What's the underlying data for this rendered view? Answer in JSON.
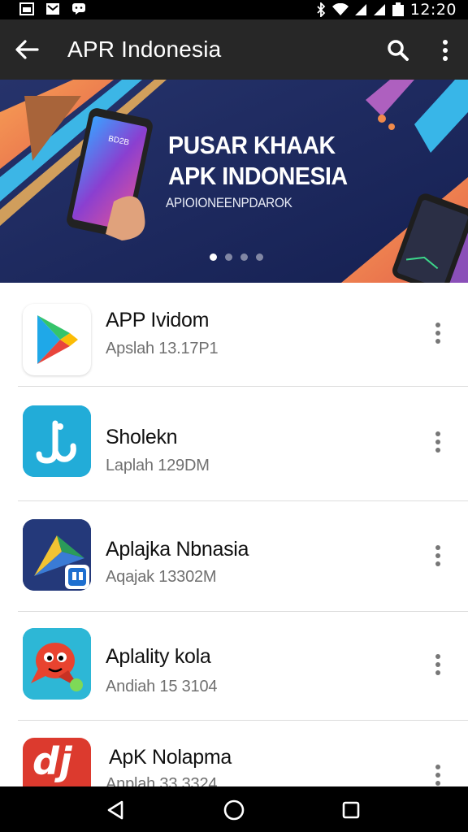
{
  "status_bar": {
    "time": "12:20",
    "icons": [
      "image-notification-icon",
      "mail-notification-icon",
      "chat-notification-icon",
      "bluetooth-icon",
      "wifi-icon",
      "signal-icon",
      "signal-icon",
      "battery-icon"
    ]
  },
  "app_bar": {
    "title": "APR Indonesia",
    "icons": [
      "back-arrow-icon",
      "search-icon",
      "more-vert-icon"
    ]
  },
  "banner": {
    "title_line1": "PUSAR KHAAK",
    "title_line2": "APK INDONESIA",
    "subtitle": "APIOIONEENPDAROK",
    "phone_screen_text": "BD2B",
    "slide_count": 4,
    "active_slide": 1,
    "colors": {
      "background": "#1d2a5e",
      "accent_orange": "#f08a4b",
      "accent_blue": "#38b6e8",
      "accent_purple": "#8a4fb8"
    }
  },
  "apps": [
    {
      "name": "APP Ividom",
      "subtitle": "Apslah 13.17P1",
      "icon": "play-store-icon"
    },
    {
      "name": "Sholekn",
      "subtitle": "Laplah 129DM",
      "icon": "blue-app-icon"
    },
    {
      "name": "Aplajka Nbnasia",
      "subtitle": "Aqajak 13302M",
      "icon": "dark-blue-app-icon"
    },
    {
      "name": "Aplality kola",
      "subtitle": "Andiah 15 3104",
      "icon": "red-character-app-icon"
    },
    {
      "name": "ApK Nolapma",
      "subtitle": "Anplah 33 3324",
      "icon": "red-dj-app-icon",
      "icon_text": "dj"
    }
  ],
  "nav_bar": {
    "icons": [
      "back-triangle-icon",
      "home-circle-icon",
      "recents-square-icon"
    ]
  }
}
